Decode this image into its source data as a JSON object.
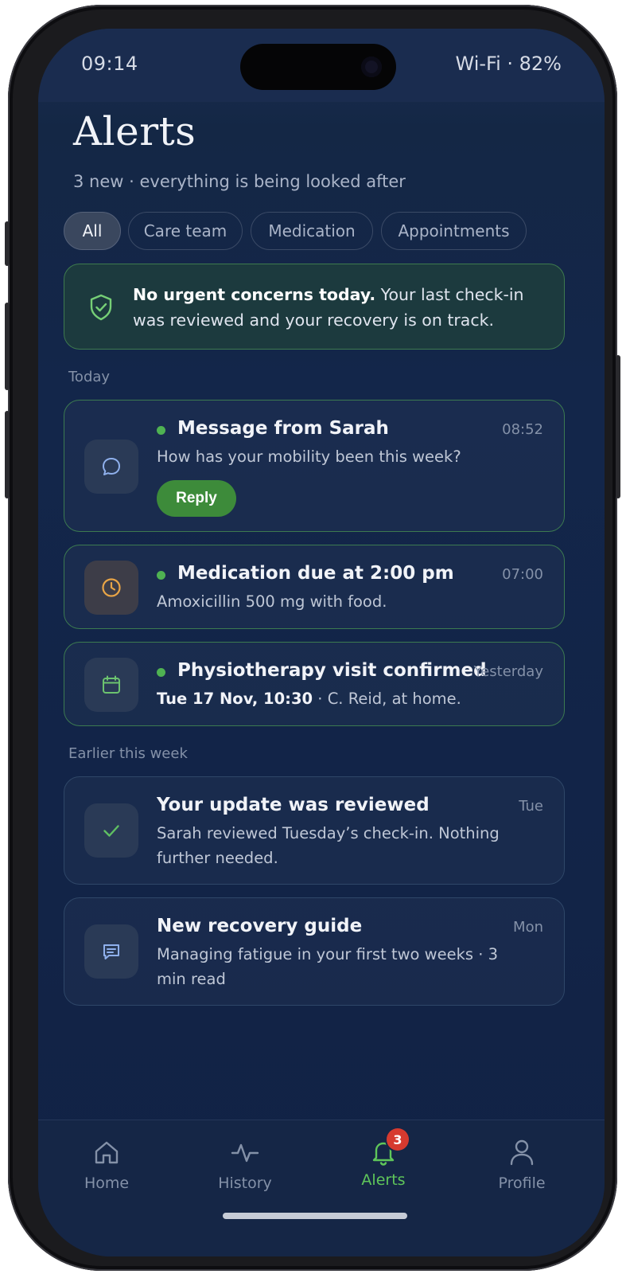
{
  "status_bar": {
    "time": "09:14",
    "connectivity": "Wi-Fi · 82%"
  },
  "header": {
    "title": "Alerts",
    "subtitle": "3 new · everything is being looked after"
  },
  "filters": [
    {
      "label": "All",
      "active": true
    },
    {
      "label": "Care team",
      "active": false
    },
    {
      "label": "Medication",
      "active": false
    },
    {
      "label": "Appointments",
      "active": false
    }
  ],
  "banner": {
    "icon": "shield-check-icon",
    "bold": "No urgent concerns today.",
    "text": " Your last check-in was reviewed and your recovery is on track."
  },
  "sections": {
    "today": "Today",
    "earlier": "Earlier this week"
  },
  "alerts": [
    {
      "icon": "chat-bubble-icon",
      "unread": true,
      "title": "Message from Sarah",
      "time": "08:52",
      "body": "How has your mobility been this week?",
      "action": "Reply"
    },
    {
      "icon": "clock-icon",
      "unread": true,
      "title": "Medication due at 2:00 pm",
      "time": "07:00",
      "body": "Amoxicillin 500 mg with food."
    },
    {
      "icon": "calendar-icon",
      "unread": true,
      "title": "Physiotherapy visit confirmed",
      "time": "Yesterday",
      "body_bold": "Tue 17 Nov, 10:30",
      "body": " · C. Reid, at home."
    },
    {
      "icon": "checkmark-icon",
      "unread": false,
      "title": "Your update was reviewed",
      "time": "Tue",
      "body": "Sarah reviewed Tuesday’s check-in. Nothing further needed."
    },
    {
      "icon": "message-lines-icon",
      "unread": false,
      "title": "New recovery guide",
      "time": "Mon",
      "body": "Managing fatigue in your first two weeks · 3 min read"
    }
  ],
  "tabbar": {
    "items": [
      {
        "label": "Home",
        "icon": "home-icon"
      },
      {
        "label": "History",
        "icon": "activity-icon"
      },
      {
        "label": "Alerts",
        "icon": "bell-icon",
        "active": true,
        "badge": "3"
      },
      {
        "label": "Profile",
        "icon": "person-icon"
      }
    ]
  },
  "colors": {
    "accent_green": "#5fc65a",
    "button_green": "#3d8b3a",
    "badge_red": "#d63a2f",
    "background": "#13264a"
  }
}
